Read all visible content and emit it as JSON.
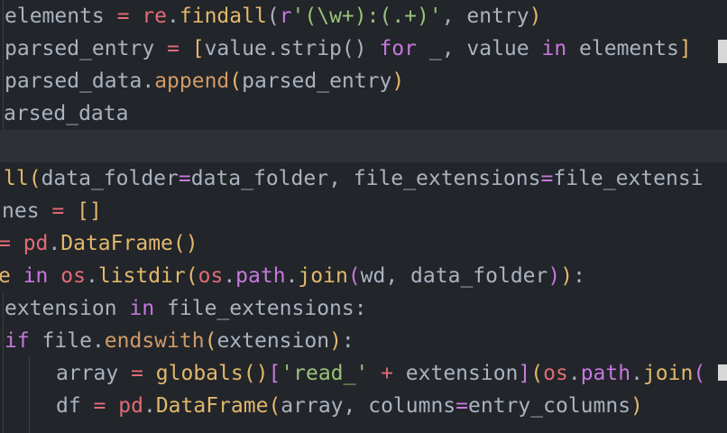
{
  "editor": {
    "lines": [
      [
        {
          "t": "elements ",
          "c": "plain"
        },
        {
          "t": "= ",
          "c": "name"
        },
        {
          "t": "re",
          "c": "mod"
        },
        {
          "t": ".",
          "c": "punc"
        },
        {
          "t": "findall",
          "c": "fn"
        },
        {
          "t": "(",
          "c": "punc"
        },
        {
          "t": "r",
          "c": "kw"
        },
        {
          "t": "'(\\w+):(.+)'",
          "c": "str"
        },
        {
          "t": ", entry",
          "c": "plain"
        },
        {
          "t": ")",
          "c": "fn"
        }
      ],
      [
        {
          "t": "parsed_entry ",
          "c": "plain"
        },
        {
          "t": "= ",
          "c": "name"
        },
        {
          "t": "[",
          "c": "fn"
        },
        {
          "t": "value.strip() ",
          "c": "plain"
        },
        {
          "t": "for",
          "c": "kw"
        },
        {
          "t": " _, value ",
          "c": "plain"
        },
        {
          "t": "in",
          "c": "kw"
        },
        {
          "t": " elements",
          "c": "plain"
        },
        {
          "t": "]",
          "c": "fn"
        }
      ],
      [
        {
          "t": "parsed_data",
          "c": "plain"
        },
        {
          "t": ".",
          "c": "punc"
        },
        {
          "t": "append",
          "c": "prop"
        },
        {
          "t": "(",
          "c": "fn"
        },
        {
          "t": "parsed_entry",
          "c": "plain"
        },
        {
          "t": ")",
          "c": "fn"
        }
      ],
      [
        {
          "t": "arsed_data",
          "c": "plain"
        }
      ],
      [],
      [
        {
          "t": "ll",
          "c": "fn"
        },
        {
          "t": "(",
          "c": "fn"
        },
        {
          "t": "data_folder",
          "c": "plain"
        },
        {
          "t": "=",
          "c": "kw"
        },
        {
          "t": "data_folder, file_extensions",
          "c": "plain"
        },
        {
          "t": "=",
          "c": "kw"
        },
        {
          "t": "file_extensi",
          "c": "plain"
        }
      ],
      [
        {
          "t": "nes ",
          "c": "plain"
        },
        {
          "t": "= ",
          "c": "name"
        },
        {
          "t": "[]",
          "c": "fn"
        }
      ],
      [
        {
          "t": "= ",
          "c": "name"
        },
        {
          "t": "pd",
          "c": "mod"
        },
        {
          "t": ".",
          "c": "punc"
        },
        {
          "t": "DataFrame",
          "c": "fn"
        },
        {
          "t": "()",
          "c": "fn"
        }
      ],
      [
        {
          "t": "e ",
          "c": "fn"
        },
        {
          "t": "in ",
          "c": "kw"
        },
        {
          "t": "os",
          "c": "mod"
        },
        {
          "t": ".",
          "c": "punc"
        },
        {
          "t": "listdir",
          "c": "fn"
        },
        {
          "t": "(",
          "c": "fn"
        },
        {
          "t": "os",
          "c": "mod"
        },
        {
          "t": ".",
          "c": "punc"
        },
        {
          "t": "path",
          "c": "kw"
        },
        {
          "t": ".",
          "c": "punc"
        },
        {
          "t": "join",
          "c": "fn"
        },
        {
          "t": "(",
          "c": "kw"
        },
        {
          "t": "wd, data_folder",
          "c": "plain"
        },
        {
          "t": ")",
          "c": "kw"
        },
        {
          "t": ")",
          "c": "fn"
        },
        {
          "t": ":",
          "c": "plain"
        }
      ],
      [
        {
          "t": "extension ",
          "c": "plain"
        },
        {
          "t": "in ",
          "c": "kw"
        },
        {
          "t": "file_extensions:",
          "c": "plain"
        }
      ],
      [
        {
          "t": "if ",
          "c": "kw"
        },
        {
          "t": "file",
          "c": "plain"
        },
        {
          "t": ".",
          "c": "punc"
        },
        {
          "t": "endswith",
          "c": "prop"
        },
        {
          "t": "(",
          "c": "fn"
        },
        {
          "t": "extension",
          "c": "plain"
        },
        {
          "t": ")",
          "c": "fn"
        },
        {
          "t": ":",
          "c": "plain"
        }
      ],
      [
        {
          "t": "array ",
          "c": "plain"
        },
        {
          "t": "= ",
          "c": "name"
        },
        {
          "t": "globals",
          "c": "fn"
        },
        {
          "t": "()",
          "c": "fn"
        },
        {
          "t": "[",
          "c": "kw"
        },
        {
          "t": "'read_'",
          "c": "str"
        },
        {
          "t": " + ",
          "c": "name"
        },
        {
          "t": "extension",
          "c": "plain"
        },
        {
          "t": "]",
          "c": "kw"
        },
        {
          "t": "(",
          "c": "fn"
        },
        {
          "t": "os",
          "c": "mod"
        },
        {
          "t": ".",
          "c": "punc"
        },
        {
          "t": "path",
          "c": "kw"
        },
        {
          "t": ".",
          "c": "punc"
        },
        {
          "t": "join",
          "c": "fn"
        },
        {
          "t": "(",
          "c": "kw"
        }
      ],
      [
        {
          "t": "df ",
          "c": "plain"
        },
        {
          "t": "= ",
          "c": "name"
        },
        {
          "t": "pd",
          "c": "mod"
        },
        {
          "t": ".",
          "c": "punc"
        },
        {
          "t": "DataFrame",
          "c": "fn"
        },
        {
          "t": "(",
          "c": "fn"
        },
        {
          "t": "array, columns",
          "c": "plain"
        },
        {
          "t": "=",
          "c": "kw"
        },
        {
          "t": "entry_columns",
          "c": "plain"
        },
        {
          "t": ")",
          "c": "fn"
        }
      ]
    ],
    "colors": {
      "background": "#22252a",
      "current_line": "#2d3036",
      "plain": "#abb2bf",
      "function": "#e2b86b",
      "operator": "#e06c75",
      "string": "#98c379",
      "keyword": "#c678dd",
      "property": "#d19a66"
    }
  }
}
